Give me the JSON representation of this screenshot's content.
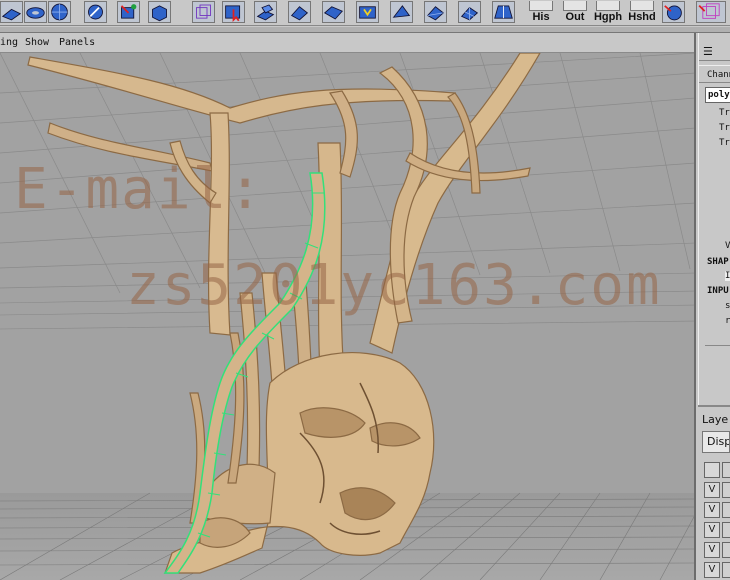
{
  "shelf": {
    "icons": [
      "polygon-plane-icon",
      "polygon-torus-icon",
      "polygon-sphere-icon",
      "sculpt-brush-icon",
      "split-polygon-icon",
      "cube-smooth-icon",
      "wire-cube-icon",
      "select-tool-icon",
      "extrude-face-icon",
      "append-polygon-icon",
      "bevel-icon",
      "merge-icon",
      "wedge-icon",
      "triangulate-icon",
      "subdivide-icon",
      "split-edge-icon",
      "cut-faces-icon"
    ],
    "buttons": [
      {
        "label": "His",
        "name": "history-button"
      },
      {
        "label": "Out",
        "name": "outliner-button"
      },
      {
        "label": "Hgph",
        "name": "hypergraph-button"
      },
      {
        "label": "Hshd",
        "name": "hypershade-button"
      }
    ],
    "end_icons": [
      "render-sphere-icon",
      "ipr-render-icon"
    ]
  },
  "panel_menu": {
    "items": [
      "ing",
      "Show",
      "Panels"
    ]
  },
  "viewport": {
    "watermark_line1": "E-mail:",
    "watermark_line2": "zs5201yc163.com"
  },
  "channel_box": {
    "menu_icon": "☰",
    "tab_label": "Chann",
    "object_name": "poly",
    "attributes": [
      "Tr",
      "Tr",
      "Tr"
    ],
    "lower_labels": [
      "V",
      "SHAP",
      "I",
      "INPU",
      "s",
      "r"
    ]
  },
  "layer_panel": {
    "tab_label": "Laye",
    "select_value": "Disp",
    "rows": [
      "",
      "V",
      "V",
      "V",
      "V",
      "V",
      "V"
    ]
  },
  "colors": {
    "tree": "#d2b48c",
    "tree_shadow": "#a07850",
    "selection": "#33e07a",
    "grid": "#7f7f7f",
    "viewport_bg": "#a2a2a2"
  }
}
